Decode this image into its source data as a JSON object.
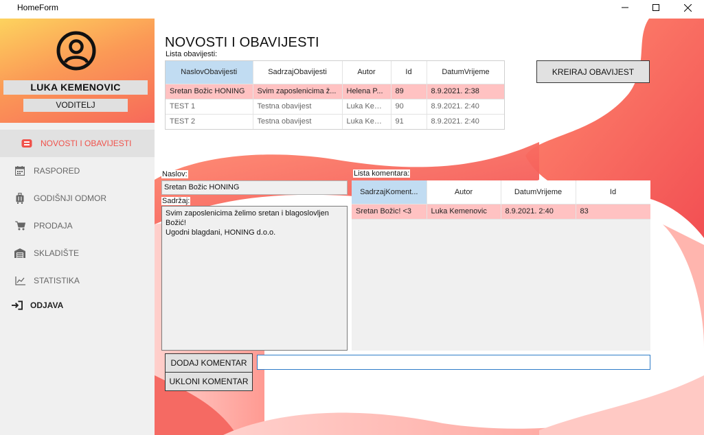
{
  "window": {
    "title": "HomeForm"
  },
  "profile": {
    "name": "LUKA KEMENOVIC",
    "role": "VODITELJ"
  },
  "sidebar": {
    "items": [
      {
        "label": "NOVOSTI I OBAVIJESTI",
        "icon": "news-icon"
      },
      {
        "label": "RASPORED",
        "icon": "calendar-icon"
      },
      {
        "label": "GODIŠNJI ODMOR",
        "icon": "suitcase-icon"
      },
      {
        "label": "PRODAJA",
        "icon": "cart-icon"
      },
      {
        "label": "SKLADIŠTE",
        "icon": "warehouse-icon"
      },
      {
        "label": "STATISTIKA",
        "icon": "chart-icon"
      }
    ],
    "logout": {
      "label": "ODJAVA",
      "icon": "logout-icon"
    }
  },
  "main": {
    "page_title": "NOVOSTI I OBAVIJESTI",
    "announcements_label": "Lista obavijesti:",
    "create_button": "KREIRAJ OBAVIJEST",
    "announcements": {
      "columns": [
        "NaslovObavijesti",
        "SadrzajObavijesti",
        "Autor",
        "Id",
        "DatumVrijeme"
      ],
      "rows": [
        [
          "Sretan Božic HONING",
          "Svim zaposlenicima ž...",
          "Helena P...",
          "89",
          "8.9.2021. 2:38"
        ],
        [
          "TEST 1",
          "Testna obavijest",
          "Luka Kem...",
          "90",
          "8.9.2021. 2:40"
        ],
        [
          "TEST 2",
          "Testna obavijest",
          "Luka Kem...",
          "91",
          "8.9.2021. 2:40"
        ]
      ]
    },
    "title_label": "Naslov:",
    "title_value": "Sretan Božic HONING",
    "content_label": "Sadržaj:",
    "content_value": "Svim zaposlenicima želimo sretan i blagoslovljen\nBožić!\nUgodni blagdani, HONING d.o.o.",
    "comments_label": "Lista komentara:",
    "comments": {
      "columns": [
        "SadrzajKoment...",
        "Autor",
        "DatumVrijeme",
        "Id"
      ],
      "rows": [
        [
          "Sretan Božic! <3",
          "Luka Kemenovic",
          "8.9.2021. 2:40",
          "83"
        ]
      ]
    },
    "add_comment_button": "DODAJ KOMENTAR",
    "remove_comment_button": "UKLONI KOMENTAR",
    "comment_input_value": ""
  },
  "colors": {
    "accent": "#f0514a",
    "selected_row": "#ffc2c2",
    "selected_header": "#c1dcf2",
    "profile_gradient_top": "#fdd35e",
    "profile_gradient_bottom": "#f7695a"
  }
}
